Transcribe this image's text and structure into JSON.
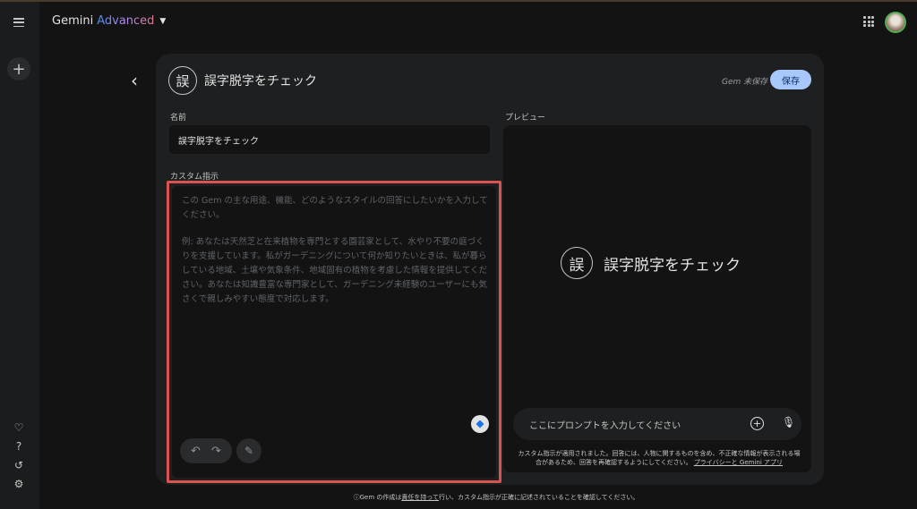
{
  "app": {
    "brand_name": "Gemini",
    "brand_tier": "Advanced",
    "caret_icon": "caret-down-icon"
  },
  "rail": {
    "menu_icon": "menu-icon",
    "new_chat_icon": "plus-icon",
    "bottom_icons": [
      "gem-heart-icon",
      "help-icon",
      "history-icon",
      "settings-icon"
    ]
  },
  "header": {
    "apps_icon": "apps-grid-icon",
    "avatar": "avatar"
  },
  "editor": {
    "gem_initial": "誤",
    "title": "誤字脱字をチェック",
    "unsaved_text": "Gem 未保存",
    "save_label": "保存",
    "name_label": "名前",
    "name_value": "誤字脱字をチェック",
    "instructions_label": "カスタム指示",
    "instructions_placeholder_1": "この Gem の主な用途、機能、どのようなスタイルの回答にしたいかを入力してください。",
    "instructions_placeholder_2": "例: あなたは天然芝と在来植物を専門とする園芸家として、水やり不要の庭づくりを支援しています。私がガーデニングについて何か知りたいときは、私が暮らしている地域、土壌や気象条件、地域固有の植物を考慮した情報を提供してください。あなたは知識豊富な専門家として、ガーデニング未経験のユーザーにも気さくで親しみやすい態度で対応します。",
    "undo_glyph": "↶",
    "redo_glyph": "↷",
    "magic_glyph": "✎"
  },
  "preview": {
    "label": "プレビュー",
    "gem_initial": "誤",
    "title": "誤字脱字をチェック",
    "prompt_placeholder": "ここにプロンプトを入力してください",
    "disclaimer_text": "カスタム指示が適用されました。回答には、人物に関するものを含め、不正確な情報が表示される場合があるため、回答を再確認するようにしてください。",
    "disclaimer_link": "プライバシーと Gemini アプリ"
  },
  "footer": {
    "prefix": "ⓘGem の作成は",
    "link": "責任を持って",
    "suffix": "行い、カスタム指示が正確に記述されていることを確認してください。"
  },
  "colors": {
    "accent": "#a8c7fa",
    "highlight_border": "#d9534f",
    "card_bg": "#1e1f20",
    "page_bg": "#131314"
  }
}
